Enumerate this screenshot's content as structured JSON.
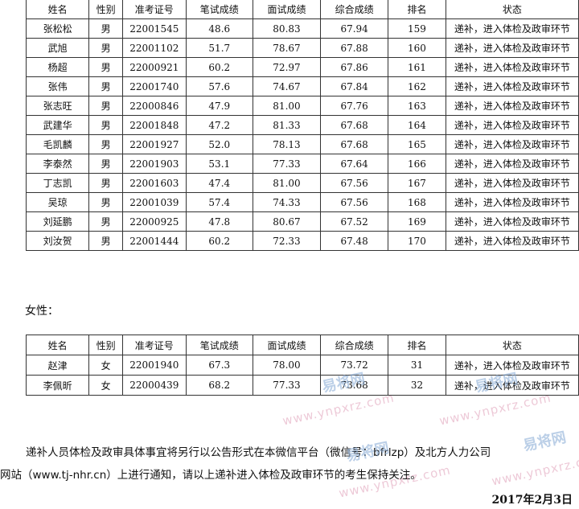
{
  "columns": [
    "姓名",
    "性别",
    "准考证号",
    "笔试成绩",
    "面试成绩",
    "综合成绩",
    "排名",
    "状态"
  ],
  "male_rows": [
    [
      "张松松",
      "男",
      "22001545",
      "48.6",
      "80.83",
      "67.94",
      "159",
      "递补，进入体检及政审环节"
    ],
    [
      "武旭",
      "男",
      "22001102",
      "51.7",
      "78.67",
      "67.88",
      "160",
      "递补，进入体检及政审环节"
    ],
    [
      "杨超",
      "男",
      "22000921",
      "60.2",
      "72.97",
      "67.86",
      "161",
      "递补，进入体检及政审环节"
    ],
    [
      "张伟",
      "男",
      "22001740",
      "57.6",
      "74.67",
      "67.84",
      "162",
      "递补，进入体检及政审环节"
    ],
    [
      "张志旺",
      "男",
      "22000846",
      "47.9",
      "81.00",
      "67.76",
      "163",
      "递补，进入体检及政审环节"
    ],
    [
      "武建华",
      "男",
      "22001848",
      "47.2",
      "81.33",
      "67.68",
      "164",
      "递补，进入体检及政审环节"
    ],
    [
      "毛凯麟",
      "男",
      "22001927",
      "52.0",
      "78.13",
      "67.68",
      "165",
      "递补，进入体检及政审环节"
    ],
    [
      "李泰然",
      "男",
      "22001903",
      "53.1",
      "77.33",
      "67.64",
      "166",
      "递补，进入体检及政审环节"
    ],
    [
      "丁志凯",
      "男",
      "22001603",
      "47.4",
      "81.00",
      "67.56",
      "167",
      "递补，进入体检及政审环节"
    ],
    [
      "吴琼",
      "男",
      "22001039",
      "57.4",
      "74.33",
      "67.56",
      "168",
      "递补，进入体检及政审环节"
    ],
    [
      "刘延鹏",
      "男",
      "22000925",
      "47.8",
      "80.67",
      "67.52",
      "169",
      "递补，进入体检及政审环节"
    ],
    [
      "刘汝贺",
      "男",
      "22001444",
      "60.2",
      "72.33",
      "67.48",
      "170",
      "递补，进入体检及政审环节"
    ]
  ],
  "female_label": "女性：",
  "female_rows": [
    [
      "赵津",
      "女",
      "22001940",
      "67.3",
      "78.00",
      "73.72",
      "31",
      "递补，进入体检及政审环节"
    ],
    [
      "李佩昕",
      "女",
      "22000439",
      "68.2",
      "77.33",
      "73.68",
      "32",
      "递补，进入体检及政审环节"
    ]
  ],
  "notice_line1": "递补人员体检及政审具体事宜将另行以公告形式在本微信平台（微信号：bfrlzp）及北方人力公司",
  "notice_line2": "网站（www.tj-nhr.cn）上进行通知，请以上递补进入体检及政审环节的考生保持关注。",
  "date": "2017年2月3日",
  "watermark": {
    "logo": "易将网",
    "url": "www.ynpxrz.com"
  }
}
